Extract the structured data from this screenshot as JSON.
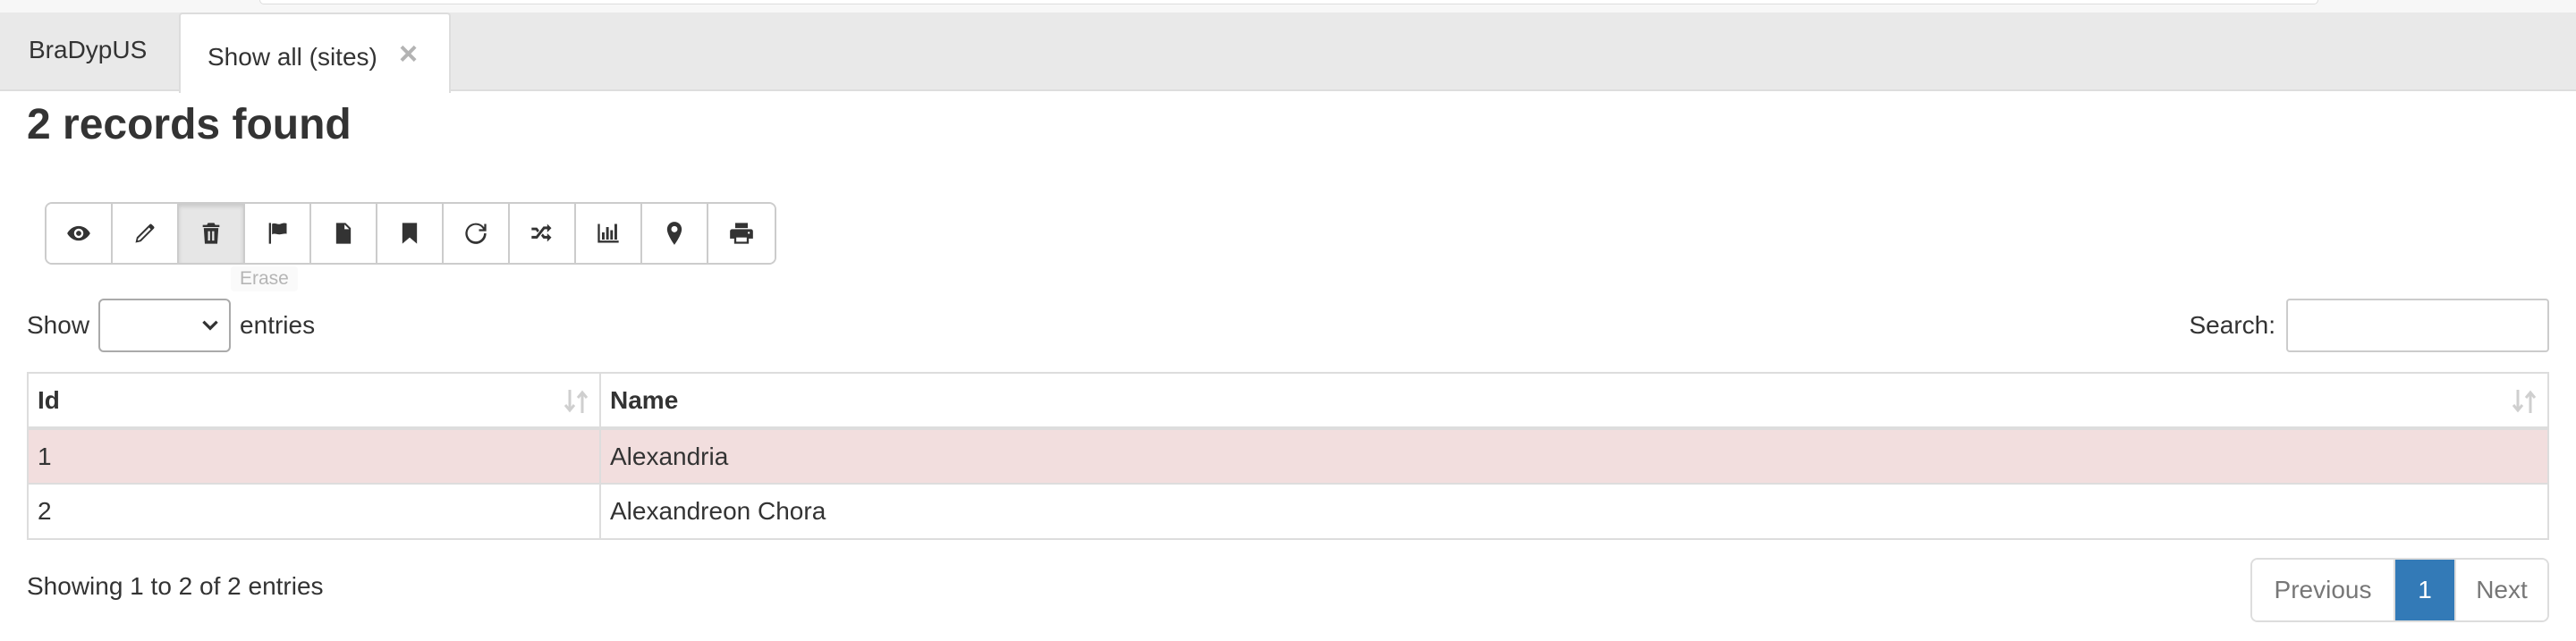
{
  "tabs": {
    "home_label": "BraDypUS",
    "active_label": "Show all (sites)",
    "close_glyph": "×"
  },
  "page_title": "2 records found",
  "toolbar": {
    "buttons": [
      {
        "icon": "eye-icon"
      },
      {
        "icon": "pencil-icon"
      },
      {
        "icon": "trash-icon",
        "active": true
      },
      {
        "icon": "flag-icon"
      },
      {
        "icon": "file-icon"
      },
      {
        "icon": "bookmark-icon"
      },
      {
        "icon": "refresh-icon"
      },
      {
        "icon": "random-icon"
      },
      {
        "icon": "stats-icon"
      },
      {
        "icon": "map-marker-icon"
      },
      {
        "icon": "print-icon"
      }
    ],
    "tooltip": "Erase"
  },
  "length_menu": {
    "prefix": "Show",
    "suffix": "entries",
    "selected": ""
  },
  "search": {
    "label": "Search:",
    "value": ""
  },
  "table": {
    "headers": [
      "Id",
      "Name"
    ],
    "rows": [
      {
        "id": "1",
        "name": "Alexandria",
        "selected": true
      },
      {
        "id": "2",
        "name": "Alexandreon Chora",
        "selected": false
      }
    ]
  },
  "info_text": "Showing 1 to 2 of 2 entries",
  "pagination": {
    "previous": "Previous",
    "current": "1",
    "next": "Next"
  },
  "colors": {
    "accent": "#337ab7",
    "selected_row": "#f2dede",
    "tabbar": "#e9e9e9"
  }
}
